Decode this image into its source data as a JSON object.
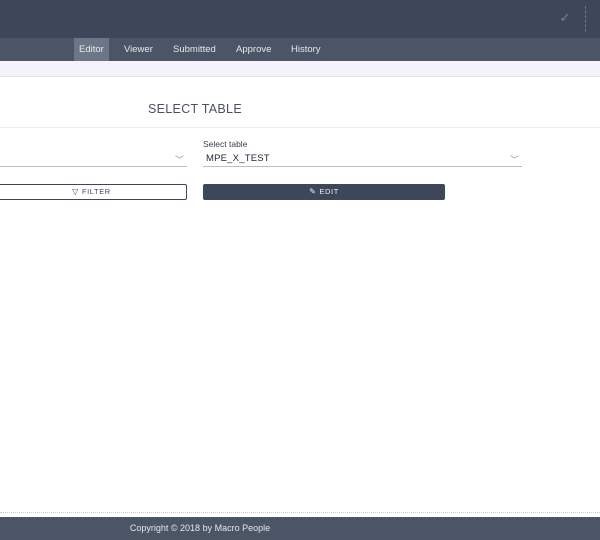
{
  "nav": {
    "items": [
      {
        "label": "Editor",
        "active": true
      },
      {
        "label": "Viewer",
        "active": false
      },
      {
        "label": "Submitted",
        "active": false
      },
      {
        "label": "Approve",
        "active": false
      },
      {
        "label": "History",
        "active": false
      }
    ]
  },
  "header": {
    "status_icon": "check-icon"
  },
  "main": {
    "title": "SELECT TABLE",
    "library_select": {
      "value": ""
    },
    "table_select": {
      "label": "Select table",
      "value": "MPE_X_TEST"
    },
    "filter_button": {
      "label": "FILTER",
      "icon": "filter-icon"
    },
    "edit_button": {
      "label": "EDIT",
      "icon": "edit-icon"
    }
  },
  "footer": {
    "copyright": "Copyright © 2018 by Macro People"
  },
  "colors": {
    "header": "#3d4759",
    "nav": "#4b5566",
    "nav_active": "#6d7686",
    "subbar": "#f4f2fb"
  }
}
